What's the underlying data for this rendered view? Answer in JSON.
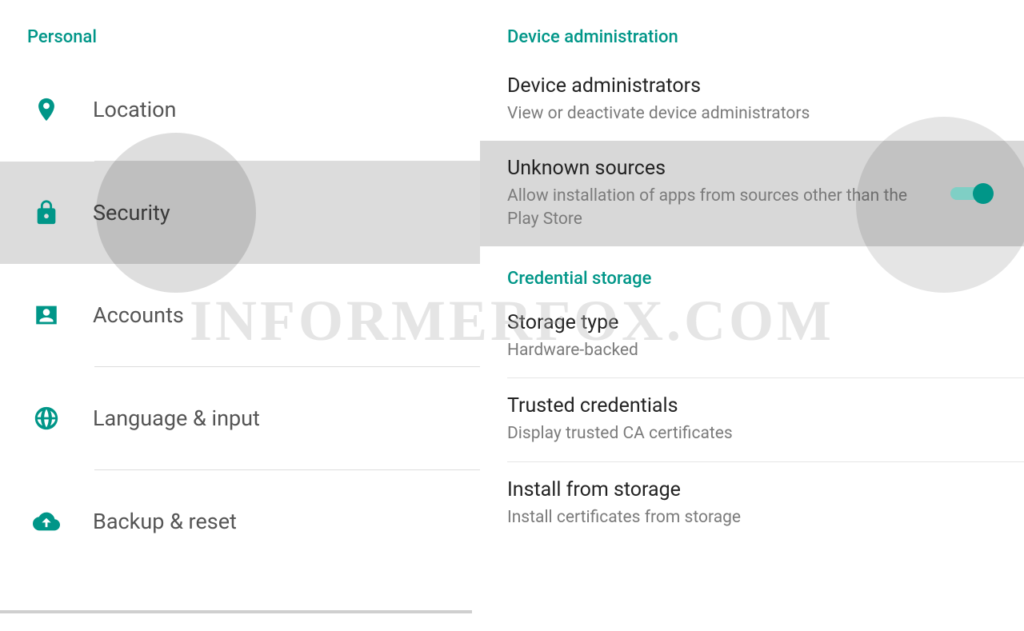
{
  "watermark": "INFORMERFOX.COM",
  "left": {
    "section": "Personal",
    "items": [
      {
        "label": "Location",
        "icon": "location"
      },
      {
        "label": "Security",
        "icon": "lock",
        "selected": true
      },
      {
        "label": "Accounts",
        "icon": "person"
      },
      {
        "label": "Language & input",
        "icon": "globe"
      },
      {
        "label": "Backup & reset",
        "icon": "cloud-up"
      }
    ]
  },
  "right": {
    "sections": [
      {
        "header": "Device administration",
        "items": [
          {
            "title": "Device administrators",
            "subtitle": "View or deactivate device administrators"
          },
          {
            "title": "Unknown sources",
            "subtitle": "Allow installation of apps from sources other than the Play Store",
            "highlighted": true,
            "toggle": true,
            "toggle_on": true
          }
        ]
      },
      {
        "header": "Credential storage",
        "items": [
          {
            "title": "Storage type",
            "subtitle": "Hardware-backed"
          },
          {
            "title": "Trusted credentials",
            "subtitle": "Display trusted CA certificates"
          },
          {
            "title": "Install from storage",
            "subtitle": "Install certificates from storage"
          }
        ]
      }
    ]
  },
  "colors": {
    "accent": "#009688"
  }
}
